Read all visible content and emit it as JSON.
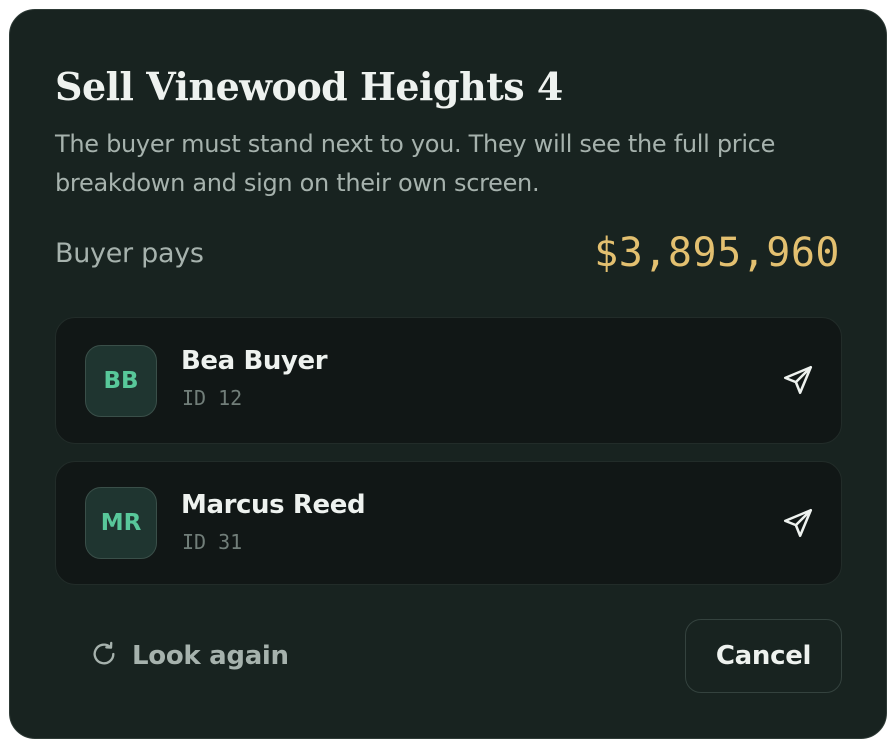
{
  "modal": {
    "title": "Sell Vinewood Heights 4",
    "subtitle": "The buyer must stand next to you. They will see the full price breakdown and sign on their own screen.",
    "pay_label": "Buyer pays",
    "pay_amount": "$3,895,960"
  },
  "buyers": [
    {
      "initials": "BB",
      "name": "Bea Buyer",
      "id_text": "ID 12",
      "icon": "send-icon"
    },
    {
      "initials": "MR",
      "name": "Marcus Reed",
      "id_text": "ID 31",
      "icon": "send-icon"
    }
  ],
  "footer": {
    "refresh_icon": "refresh-icon",
    "look_again_label": "Look again",
    "cancel_label": "Cancel"
  },
  "colors": {
    "background": "#182320",
    "card": "#111716",
    "accent_amount": "#e3c070",
    "avatar_text": "#58c89a"
  }
}
